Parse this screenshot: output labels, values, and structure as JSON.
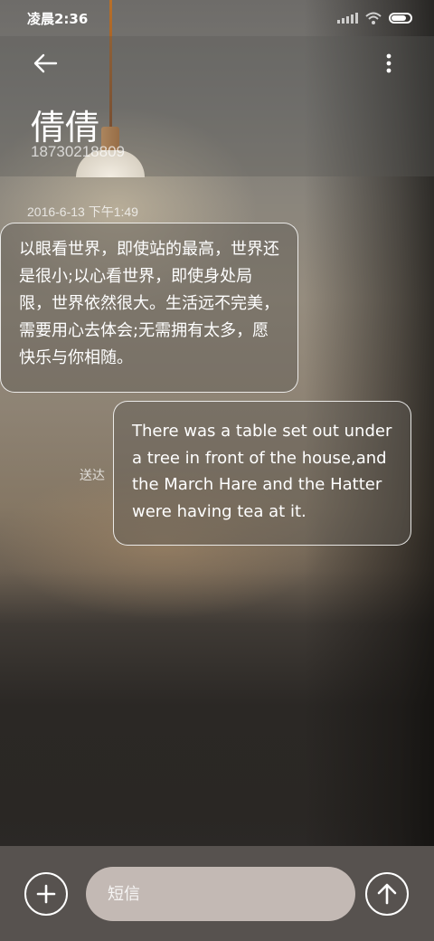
{
  "status_bar": {
    "time": "凌晨2:36",
    "icons": [
      "signal-icon",
      "wifi-icon",
      "battery-icon"
    ]
  },
  "header": {
    "back_icon": "arrow-left-icon",
    "more_icon": "more-vertical-icon",
    "contact_name": "倩倩",
    "contact_number": "18730218809"
  },
  "conversation": {
    "timestamp": "2016-6-13 下午1:49",
    "messages": [
      {
        "direction": "incoming",
        "text": "以眼看世界，即使站的最高，世界还是很小;以心看世界，即使身处局限，世界依然很大。生活远不完美，需要用心去体会;无需拥有太多，愿快乐与你相随。"
      },
      {
        "direction": "outgoing",
        "text": "There was a table set out under a tree in front of the house,and the March Hare and the Hatter were having tea at it.",
        "status": "送达"
      }
    ]
  },
  "composer": {
    "add_icon": "plus-icon",
    "placeholder": "短信",
    "send_icon": "arrow-up-icon"
  },
  "colors": {
    "input_bar": "#57524f",
    "input_field": "#c3b9b4"
  }
}
